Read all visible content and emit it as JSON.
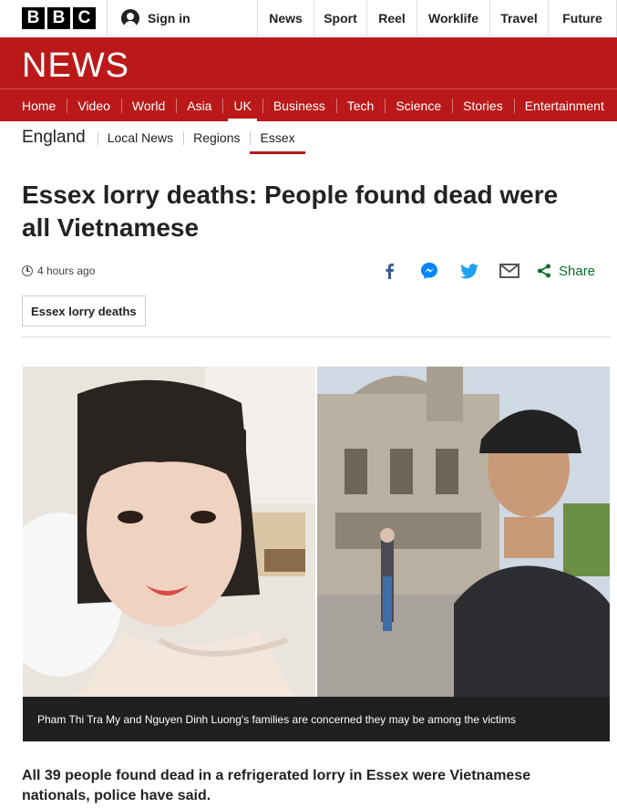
{
  "brand": {
    "logo_letters": [
      "B",
      "B",
      "C"
    ],
    "news_wordmark": "NEWS",
    "accent_color": "#bb1919",
    "share_color": "#0a6d2b"
  },
  "topbar": {
    "signin_label": "Sign in",
    "nav": [
      "News",
      "Sport",
      "Reel",
      "Worklife",
      "Travel",
      "Future"
    ]
  },
  "main_nav": {
    "items": [
      "Home",
      "Video",
      "World",
      "Asia",
      "UK",
      "Business",
      "Tech",
      "Science",
      "Stories",
      "Entertainment"
    ],
    "active": "UK"
  },
  "sub_nav": {
    "section": "England",
    "items": [
      "Local News",
      "Regions",
      "Essex"
    ],
    "active": "Essex"
  },
  "article": {
    "headline": "Essex lorry deaths: People found dead were all Vietnamese",
    "timestamp": "4 hours ago",
    "share_icons": [
      "facebook-icon",
      "messenger-icon",
      "twitter-icon",
      "email-icon",
      "share-icon"
    ],
    "share_label": "Share",
    "topic_tag": "Essex lorry deaths",
    "image_caption": "Pham Thi Tra My and Nguyen Dinh Luong's families are concerned they may be among the victims",
    "intro": "All 39 people found dead in a refrigerated lorry in Essex were Vietnamese nationals, police have said."
  }
}
